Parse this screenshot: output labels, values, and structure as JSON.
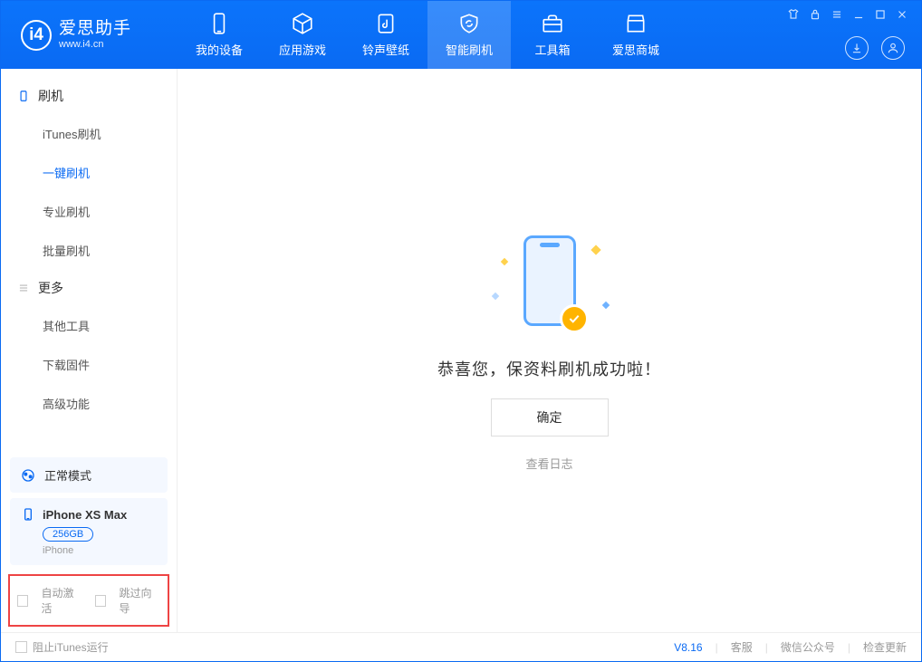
{
  "app": {
    "name": "爱思助手",
    "url": "www.i4.cn"
  },
  "nav": {
    "items": [
      {
        "label": "我的设备"
      },
      {
        "label": "应用游戏"
      },
      {
        "label": "铃声壁纸"
      },
      {
        "label": "智能刷机"
      },
      {
        "label": "工具箱"
      },
      {
        "label": "爱思商城"
      }
    ],
    "activeIndex": 3
  },
  "sidebar": {
    "group1": {
      "title": "刷机",
      "items": [
        "iTunes刷机",
        "一键刷机",
        "专业刷机",
        "批量刷机"
      ],
      "activeIndex": 1
    },
    "group2": {
      "title": "更多",
      "items": [
        "其他工具",
        "下载固件",
        "高级功能"
      ]
    },
    "mode": {
      "label": "正常模式"
    },
    "device": {
      "name": "iPhone XS Max",
      "capacity": "256GB",
      "type": "iPhone"
    },
    "checks": {
      "autoActivate": "自动激活",
      "skipGuide": "跳过向导"
    }
  },
  "main": {
    "successMsg": "恭喜您，保资料刷机成功啦！",
    "okBtn": "确定",
    "viewLog": "查看日志"
  },
  "footer": {
    "blockItunes": "阻止iTunes运行",
    "version": "V8.16",
    "links": [
      "客服",
      "微信公众号",
      "检查更新"
    ]
  }
}
